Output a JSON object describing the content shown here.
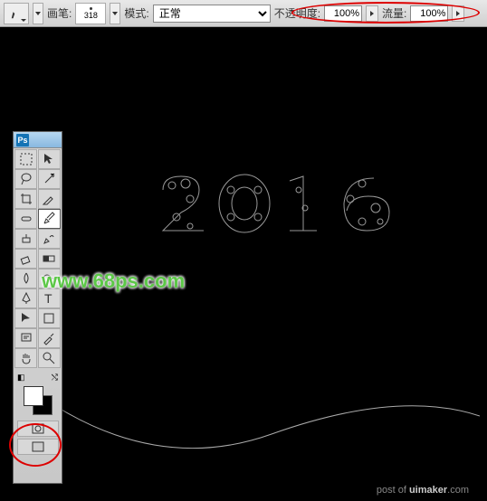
{
  "options_bar": {
    "brush_label": "画笔:",
    "brush_size": "318",
    "mode_label": "模式:",
    "mode_value": "正常",
    "opacity_label": "不透明度:",
    "opacity_value": "100%",
    "flow_label": "流量:",
    "flow_value": "100%"
  },
  "toolbox": {
    "logo": "Ps",
    "fg_color": "#ffffff",
    "bg_color": "#000000"
  },
  "canvas": {
    "decorative_year": "2016"
  },
  "watermark": "www.68ps.com",
  "footer": {
    "prefix": "post of ",
    "site": "uimaker",
    "suffix": ".com"
  }
}
